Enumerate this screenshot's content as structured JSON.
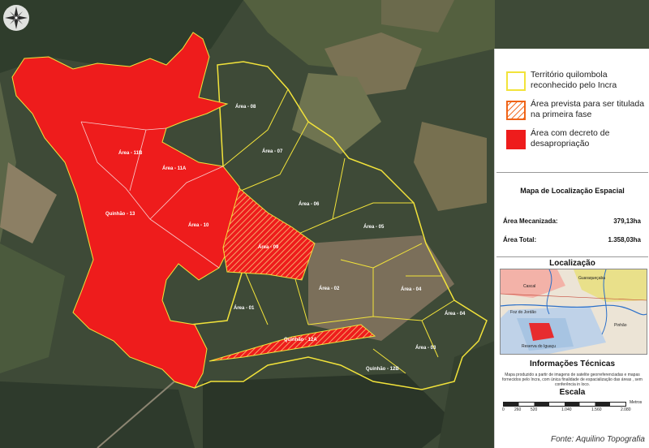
{
  "colors": {
    "red": "#ee1c1c",
    "yellow": "#f2e33a",
    "orange": "#f06418",
    "panel_bg": "#ffffff"
  },
  "compass": {
    "icon": "compass-rose-icon"
  },
  "legend": {
    "items": [
      {
        "label": "Território quilombola reconhecido pelo Incra",
        "icon": "yellow-outline-swatch"
      },
      {
        "label": "Área prevista para ser titulada na primeira fase",
        "icon": "orange-hatch-swatch"
      },
      {
        "label": "Área com decreto de desapropriação",
        "icon": "red-fill-swatch"
      }
    ]
  },
  "summary": {
    "title": "Mapa de Localização Espacial",
    "rows": [
      {
        "label": "Área Mecanizada:",
        "value": "379,13ha"
      },
      {
        "label": "Área Total:",
        "value": "1.358,03ha"
      }
    ]
  },
  "location": {
    "title": "Localização",
    "places": [
      "Cascal",
      "Guaraqueçaba",
      "Foz do Jordão",
      "Pinhão",
      "Reserva do Iguaçu"
    ]
  },
  "technical": {
    "title": "Informações Técnicas",
    "text": "Mapa produzido a partir de imagens de satelite georreferenciadas e mapas fornecidos pelo Incra, com única finalidade de espacialização das áreas , sem conferência in loco."
  },
  "scale": {
    "title": "Escala",
    "unit": "Metros",
    "ticks": [
      "0",
      "260",
      "520",
      "1.040",
      "1.560",
      "2.080"
    ]
  },
  "footer": {
    "credit": "Fonte: Aquilino Topografia"
  },
  "areas": [
    {
      "label": "Área - 08"
    },
    {
      "label": "Área - 11B"
    },
    {
      "label": "Área - 11A"
    },
    {
      "label": "Área - 07"
    },
    {
      "label": "Quinhão - 13"
    },
    {
      "label": "Área - 10"
    },
    {
      "label": "Área - 06"
    },
    {
      "label": "Área - 09"
    },
    {
      "label": "Área - 05"
    },
    {
      "label": "Área - 01"
    },
    {
      "label": "Área - 02"
    },
    {
      "label": "Área - 04"
    },
    {
      "label": "Área - 04"
    },
    {
      "label": "Quinhão - 12A"
    },
    {
      "label": "Área - 03"
    },
    {
      "label": "Quinhão - 12B"
    }
  ]
}
